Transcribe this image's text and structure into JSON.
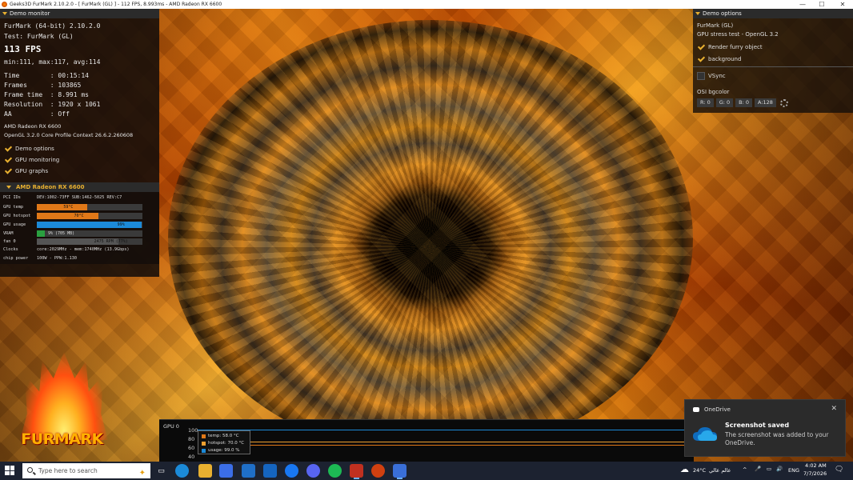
{
  "window": {
    "title": "Geeks3D FurMark 2.10.2.0 - [ FurMark (GL) ] - 112 FPS, 8.993ms - AMD Radeon RX 6600",
    "minimize": "—",
    "maximize": "☐",
    "close": "✕"
  },
  "left_panel": {
    "header": "Demo monitor",
    "app_version": "FurMark (64-bit) 2.10.2.0",
    "test": "Test: FurMark (GL)",
    "fps": "113 FPS",
    "fps_stats": "min:111, max:117, avg:114",
    "time": "Time        : 00:15:14",
    "frames": "Frames      : 103865",
    "frame_time": "Frame time  : 8.991 ms",
    "resolution": "Resolution  : 1920 x 1061",
    "aa": "AA          : Off",
    "gpu_name": "AMD Radeon RX 6600",
    "gl_info": "OpenGL 3.2.0 Core Profile Context 26.6.2.260608",
    "checks": [
      {
        "label": "Demo options",
        "checked": true
      },
      {
        "label": "GPU monitoring",
        "checked": true
      },
      {
        "label": "GPU graphs",
        "checked": true
      }
    ]
  },
  "gpu_monitor": {
    "header": "AMD Radeon RX 6600",
    "pci_label": "PCI IDs",
    "pci_value": "DEV:1002-73FF SUB:1462-5025 REV:C7",
    "rows": [
      {
        "label": "GPU temp",
        "text": "59°C",
        "fill": 0.48,
        "color": "#e07818"
      },
      {
        "label": "GPU hotspot",
        "text": "70°C",
        "fill": 0.58,
        "color": "#e07818"
      },
      {
        "label": "GPU usage",
        "text": "99%",
        "fill": 0.99,
        "color": "#1c8ad8"
      },
      {
        "label": "VRAM",
        "text": "9% (705 MB)",
        "fill": 0.09,
        "color": "#2aa040"
      },
      {
        "label": "fan 0",
        "text": "2475 RPM (77%)",
        "fill": 0.77,
        "color": "#555555"
      }
    ],
    "clocks_label": "Clocks",
    "clocks_value": "core:2029MHz - mem:1740MHz (13.9Gbps)",
    "power_label": "chip power",
    "power_value": "100W - PPW:1.130"
  },
  "right_panel": {
    "header": "Demo options",
    "demo": "FurMark (GL)",
    "subtitle": "GPU stress test - OpenGL 3.2",
    "checks": [
      {
        "label": "Render furry object",
        "checked": true
      },
      {
        "label": "background",
        "checked": true
      },
      {
        "label": "VSync",
        "checked": false
      }
    ],
    "osi_label": "OSI bgcolor",
    "r": "R: 0",
    "g": "G: 0",
    "b": "B: 0",
    "a": "A:128"
  },
  "logo": {
    "text": "FURMARK"
  },
  "graph": {
    "label": "GPU 0",
    "axis": [
      "100",
      "80",
      "60",
      "40"
    ],
    "legend": [
      {
        "label": "temp: 58.0 °C",
        "color": "#e07818"
      },
      {
        "label": "hotspot: 70.0 °C",
        "color": "#f0a030"
      },
      {
        "label": "usage: 99.0 %",
        "color": "#1c8ad8"
      }
    ]
  },
  "toast": {
    "app": "OneDrive",
    "title": "Screenshot saved",
    "message": "The screenshot was added to your OneDrive.",
    "close": "✕"
  },
  "taskbar": {
    "search_placeholder": "Type here to search",
    "weather": "24°C",
    "weather_text": "عالم عالي",
    "lang": "ENG",
    "time": "4:02 AM",
    "date": "7/7/2026"
  }
}
